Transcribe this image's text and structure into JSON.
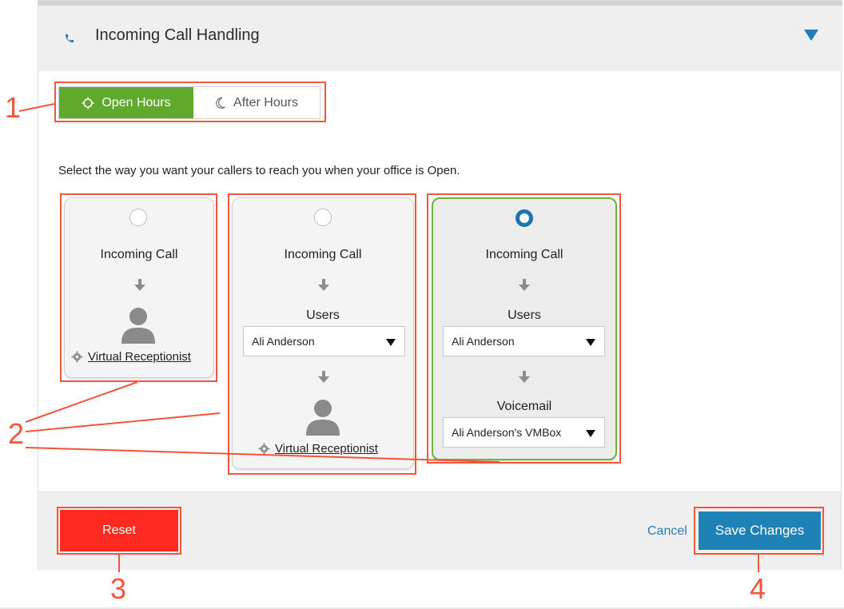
{
  "header": {
    "title": "Incoming Call Handling"
  },
  "toggle": {
    "open_label": "Open Hours",
    "after_label": "After Hours"
  },
  "instructions": "Select the way you want your callers to reach you when your office is Open.",
  "cards": [
    {
      "selected": false,
      "incoming_label": "Incoming Call",
      "receptionist_label": "Virtual Receptionist"
    },
    {
      "selected": false,
      "incoming_label": "Incoming Call",
      "users_label": "Users",
      "users_value": "Ali Anderson",
      "receptionist_label": "Virtual Receptionist"
    },
    {
      "selected": true,
      "incoming_label": "Incoming Call",
      "users_label": "Users",
      "users_value": "Ali Anderson",
      "voicemail_label": "Voicemail",
      "voicemail_value": "Ali Anderson's VMBox"
    }
  ],
  "footer": {
    "reset_label": "Reset",
    "cancel_label": "Cancel",
    "save_label": "Save Changes"
  },
  "annotations": [
    "1",
    "2",
    "3",
    "4"
  ],
  "colors": {
    "accent_green": "#5faa2d",
    "accent_blue": "#1f82b7",
    "reset_red": "#ff2a1f",
    "annotation_red": "#f2553a"
  },
  "icons": [
    "phone-icon",
    "sun-icon",
    "moon-icon",
    "arrow-down-icon",
    "person-icon",
    "gear-icon",
    "chevron-down-icon"
  ]
}
